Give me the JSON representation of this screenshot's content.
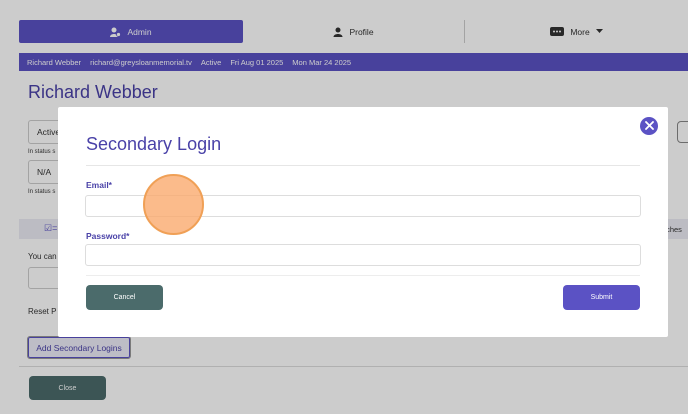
{
  "tabs": {
    "admin": "Admin",
    "profile": "Profile",
    "more": "More"
  },
  "infobar": {
    "name": "Richard Webber",
    "email": "richard@greysloanmemorial.tv",
    "status": "Active",
    "date1": "Fri Aug 01 2025",
    "date2": "Mon Mar 24 2025"
  },
  "background": {
    "heading": "Richard Webber",
    "select1": "Active",
    "small1": "In status s",
    "select2": "N/A",
    "small2": "In status s",
    "you_can": "You can",
    "reset": "Reset P",
    "right_text": "tches",
    "add_secondary": "Add Secondary Logins",
    "close": "Close"
  },
  "modal": {
    "title": "Secondary Login",
    "email_label": "Email*",
    "email_value": "",
    "password_label": "Password*",
    "password_value": "",
    "cancel": "Cancel",
    "submit": "Submit"
  },
  "colors": {
    "accent": "#5b52c4",
    "secondary_button": "#4b6b6b"
  }
}
